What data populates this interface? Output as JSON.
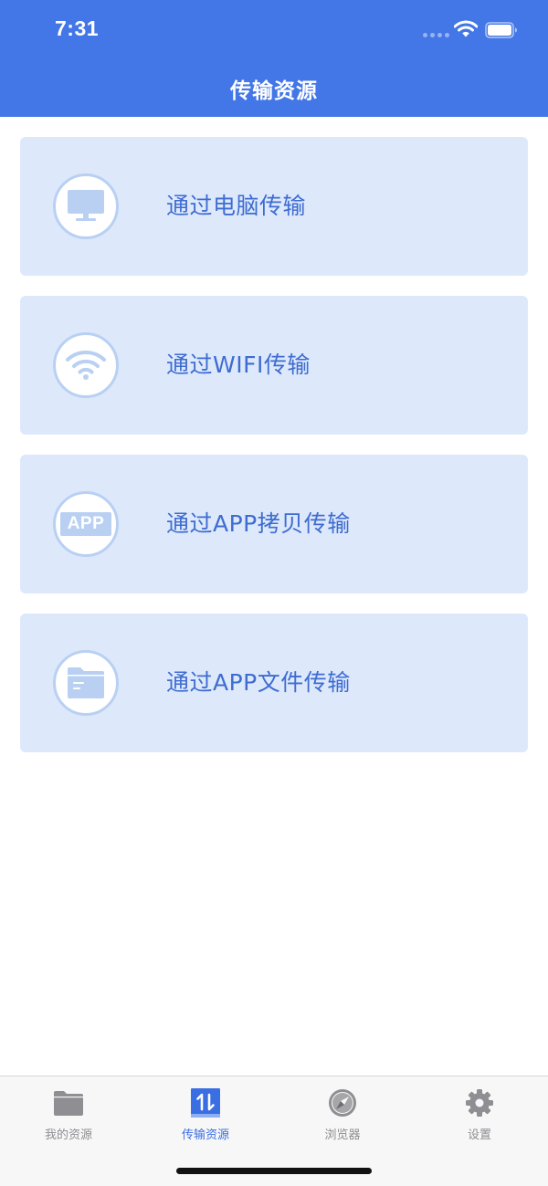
{
  "status_bar": {
    "time": "7:31"
  },
  "nav": {
    "title": "传输资源"
  },
  "options": [
    {
      "label": "通过电脑传输",
      "icon": "computer-icon"
    },
    {
      "label": "通过WIFI传输",
      "icon": "wifi-icon"
    },
    {
      "label": "通过APP拷贝传输",
      "icon": "app-icon",
      "icon_text": "APP"
    },
    {
      "label": "通过APP文件传输",
      "icon": "folder-icon"
    }
  ],
  "tabbar": {
    "active": "传输资源",
    "tabs": [
      {
        "label": "我的资源",
        "icon": "folder-icon"
      },
      {
        "label": "传输资源",
        "icon": "transfer-icon"
      },
      {
        "label": "浏览器",
        "icon": "compass-icon"
      },
      {
        "label": "设置",
        "icon": "gear-icon"
      }
    ]
  },
  "colors": {
    "header": "#4376e6",
    "card_bg": "#dde9fb",
    "card_text": "#3f6cd1",
    "icon_light": "#b9d0f3",
    "tab_active": "#3a6ee3",
    "tab_inactive": "#8e8e93"
  }
}
